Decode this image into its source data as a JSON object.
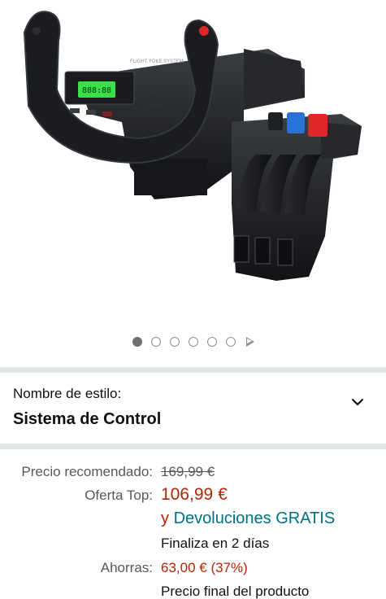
{
  "carousel": {
    "total": 6,
    "active_index": 0
  },
  "style": {
    "label": "Nombre de estilo:",
    "value": "Sistema de Control"
  },
  "yoke_display": {
    "header": "FLIGHT YOKE SYSTEM",
    "screen": "888:88"
  },
  "pricing": {
    "list_label": "Precio recomendado:",
    "list_price": "169,99 €",
    "deal_label": "Oferta Top:",
    "deal_price": "106,99 €",
    "returns_prefix": "y",
    "returns_link": "Devoluciones GRATIS",
    "ends": "Finaliza en 2 días",
    "savings_label": "Ahorras:",
    "savings_value": "63,00 € (37%)",
    "final_price_note": "Precio final del producto"
  },
  "colors": {
    "deal_red": "#b12704",
    "link_teal": "#007185",
    "muted_text": "#565959",
    "divider": "#e3e6e6",
    "yoke_display_green": "#39e04a",
    "lever_red": "#e0262a",
    "lever_blue": "#2a73d6"
  },
  "icons": {
    "carousel_next": "play-icon",
    "style_dropdown": "chevron-down-icon"
  }
}
